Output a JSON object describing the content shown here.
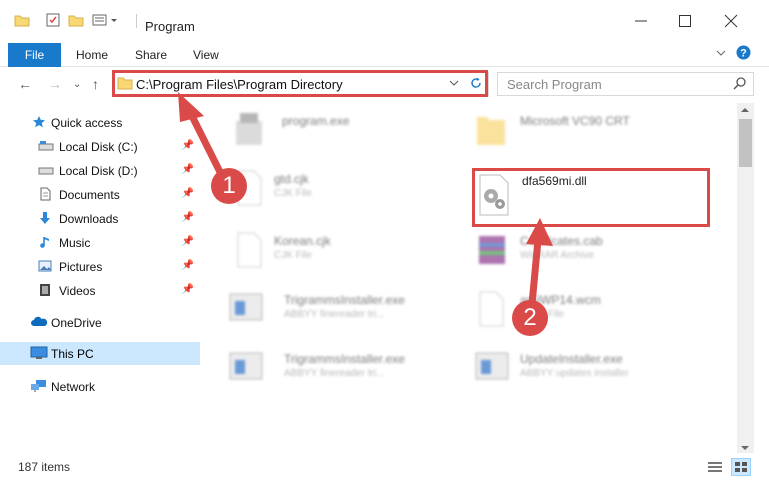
{
  "window": {
    "title": "Program"
  },
  "ribbon": {
    "tabs": [
      "File",
      "Home",
      "Share",
      "View"
    ]
  },
  "address": {
    "path": "C:\\Program Files\\Program Directory"
  },
  "search": {
    "placeholder": "Search Program"
  },
  "sidebar": {
    "items": [
      {
        "label": "Quick access"
      },
      {
        "label": "Local Disk (C:)"
      },
      {
        "label": "Local Disk (D:)"
      },
      {
        "label": "Documents"
      },
      {
        "label": "Downloads"
      },
      {
        "label": "Music"
      },
      {
        "label": "Pictures"
      },
      {
        "label": "Videos"
      },
      {
        "label": "OneDrive"
      },
      {
        "label": "This PC"
      },
      {
        "label": "Network"
      }
    ]
  },
  "files": [
    {
      "name": "program.exe",
      "type": ""
    },
    {
      "name": "Microsoft VC90 CRT",
      "type": ""
    },
    {
      "name": "gtd.cjk",
      "type": "CJK File"
    },
    {
      "name": "dfa569mi.dll",
      "type": ""
    },
    {
      "name": "Korean.cjk",
      "type": "CJK File"
    },
    {
      "name": "Certificates.cab",
      "type": "WinRAR Archive"
    },
    {
      "name": "TrigrammsInstaller.exe",
      "type": "ABBYY finereader tri..."
    },
    {
      "name": "ar5iWP14.wcm",
      "type": "WCM File"
    },
    {
      "name": "TrigrammsInstaller.exe",
      "type": "ABBYY finereader tri..."
    },
    {
      "name": "UpdateInstaller.exe",
      "type": "ABBYY updates installer"
    }
  ],
  "status": {
    "items": "187 items"
  },
  "annotations": {
    "badge1": "1",
    "badge2": "2"
  },
  "colors": {
    "accent": "#1979ca",
    "highlight": "#d94a48",
    "selected": "#cce8ff"
  }
}
